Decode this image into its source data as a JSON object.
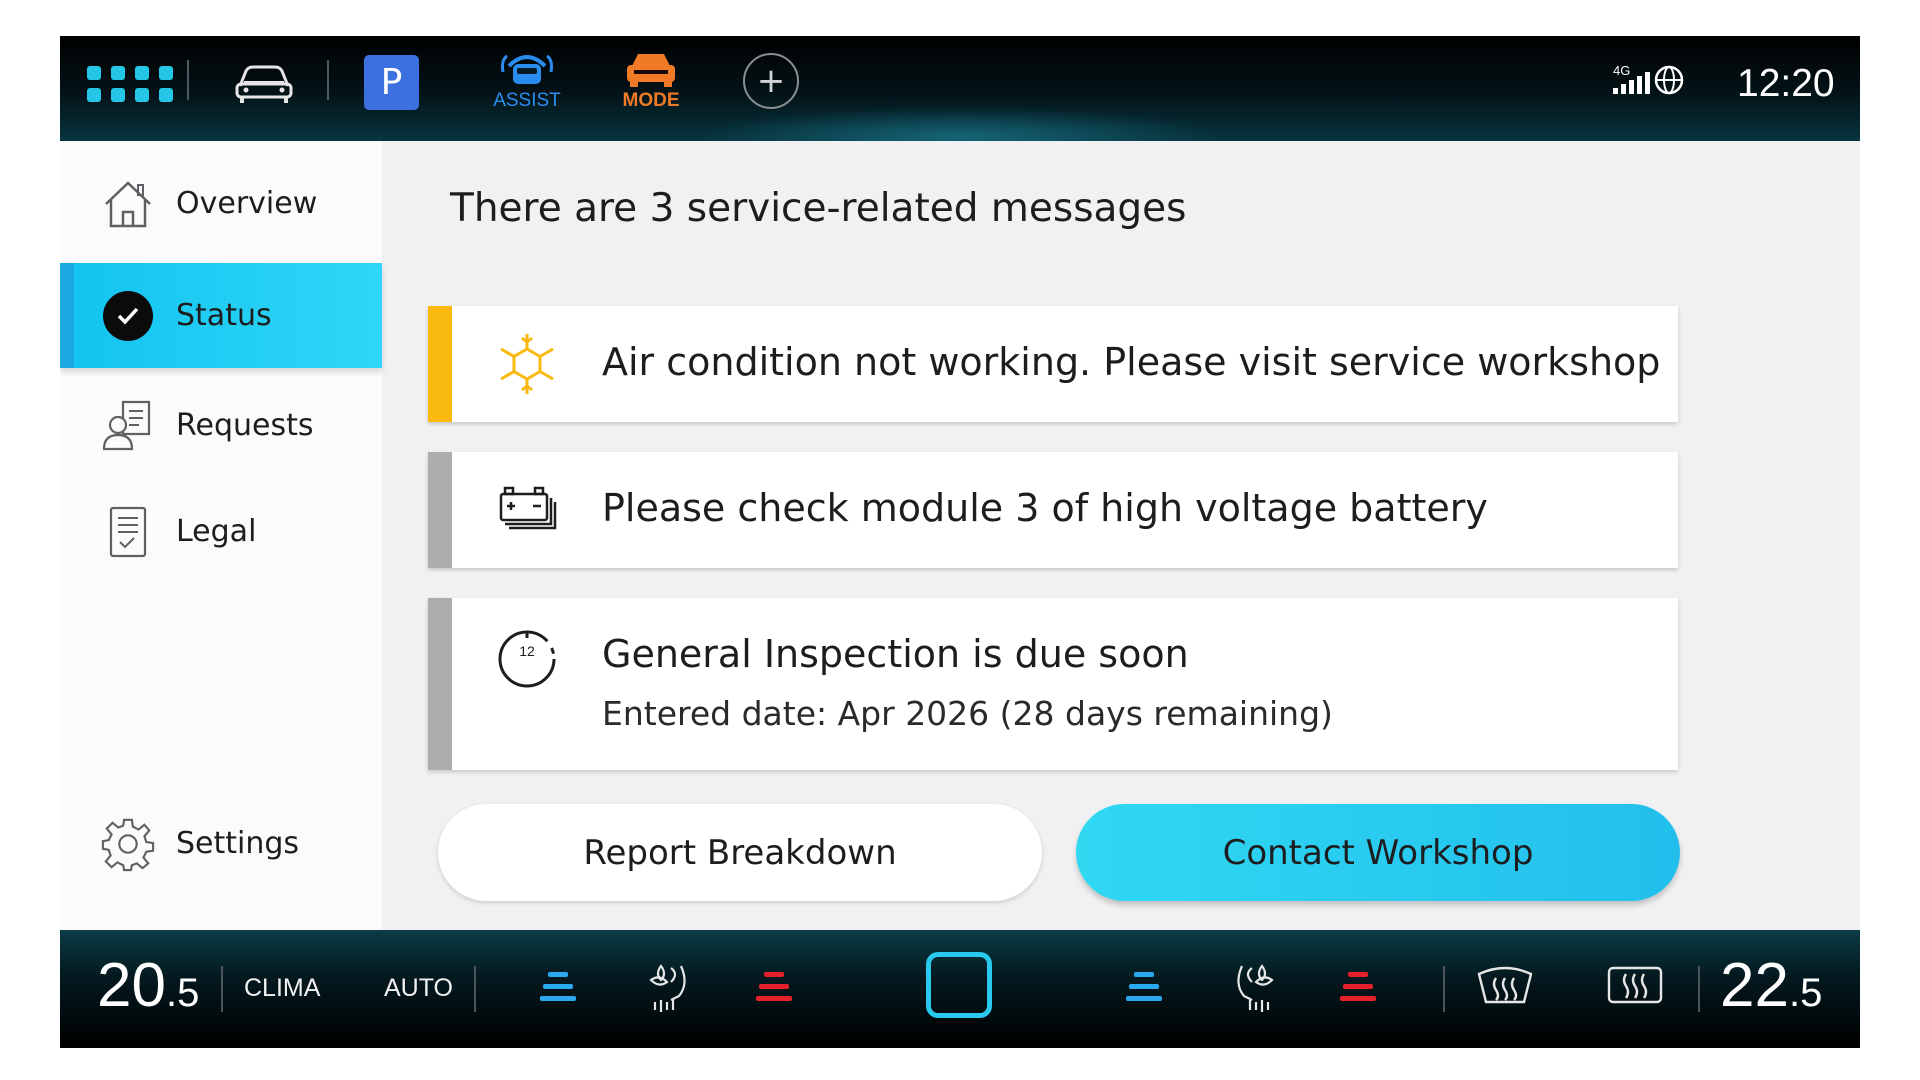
{
  "topbar": {
    "assist_label": "ASSIST",
    "mode_label": "MODE",
    "parking_label": "P",
    "plus_label": "+",
    "network": "4G",
    "time": "12:20",
    "icons": [
      "apps-grid-icon",
      "car-icon",
      "parking-icon",
      "assist-icon",
      "mode-icon",
      "add-icon",
      "signal-icon",
      "globe-icon"
    ]
  },
  "sidebar": {
    "items": [
      {
        "label": "Overview",
        "icon": "home-icon",
        "active": false
      },
      {
        "label": "Status",
        "icon": "check-circle-icon",
        "active": true
      },
      {
        "label": "Requests",
        "icon": "person-document-icon",
        "active": false
      },
      {
        "label": "Legal",
        "icon": "document-check-icon",
        "active": false
      }
    ],
    "settings_label": "Settings"
  },
  "main": {
    "heading": "There are 3 service-related messages",
    "messages": [
      {
        "title": "Air condition not working.  Please visit service workshop",
        "subtitle": "",
        "icon": "snowflake-sun-icon",
        "accent": "#f9b90f"
      },
      {
        "title": "Please check module 3 of high voltage battery",
        "subtitle": "",
        "icon": "battery-icon",
        "accent": "#adadad"
      },
      {
        "title": "General Inspection is due soon",
        "subtitle": "Entered date: Apr 2026 (28 days remaining)",
        "icon": "clock-icon",
        "clock_number": "12",
        "accent": "#adadad"
      }
    ],
    "buttons": {
      "report": "Report Breakdown",
      "contact": "Contact Workshop"
    }
  },
  "climate": {
    "left_temp_int": "20",
    "left_temp_dec": ".5",
    "clima_label": "CLIMA",
    "auto_label": "AUTO",
    "right_temp_int": "22",
    "right_temp_dec": ".5"
  },
  "colors": {
    "accent_cyan": "#25c7e8",
    "assist_blue": "#2b8cf0",
    "mode_orange": "#f07a26",
    "warning_yellow": "#f9b90f",
    "seat_cool_blue": "#2aa8f0",
    "seat_heat_red": "#e5202b"
  }
}
